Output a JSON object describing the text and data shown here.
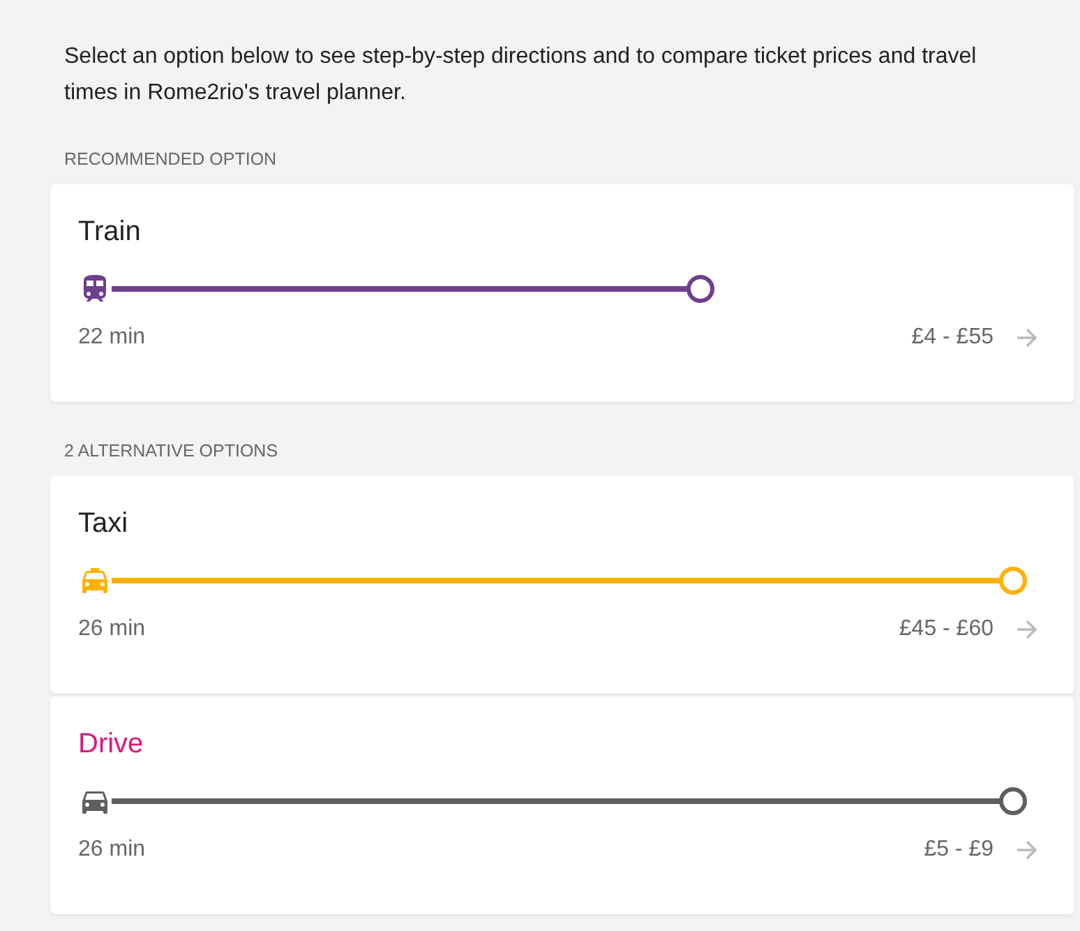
{
  "intro": "Select an option below to see step-by-step directions and to compare ticket prices and travel times in Rome2rio's travel planner.",
  "sections": [
    {
      "heading": "RECOMMENDED OPTION",
      "options": [
        {
          "title": "Train",
          "kind": "train",
          "color": "#6e3f8c",
          "highlighted": false,
          "duration": "22 min",
          "price": "£4 - £55"
        }
      ]
    },
    {
      "heading": "2 ALTERNATIVE OPTIONS",
      "options": [
        {
          "title": "Taxi",
          "kind": "taxi",
          "color": "#ffb000",
          "highlighted": false,
          "duration": "26 min",
          "price": "£45 - £60"
        },
        {
          "title": "Drive",
          "kind": "car",
          "color": "#5f5f5f",
          "highlighted": true,
          "duration": "26 min",
          "price": "£5 - £9"
        }
      ]
    }
  ]
}
